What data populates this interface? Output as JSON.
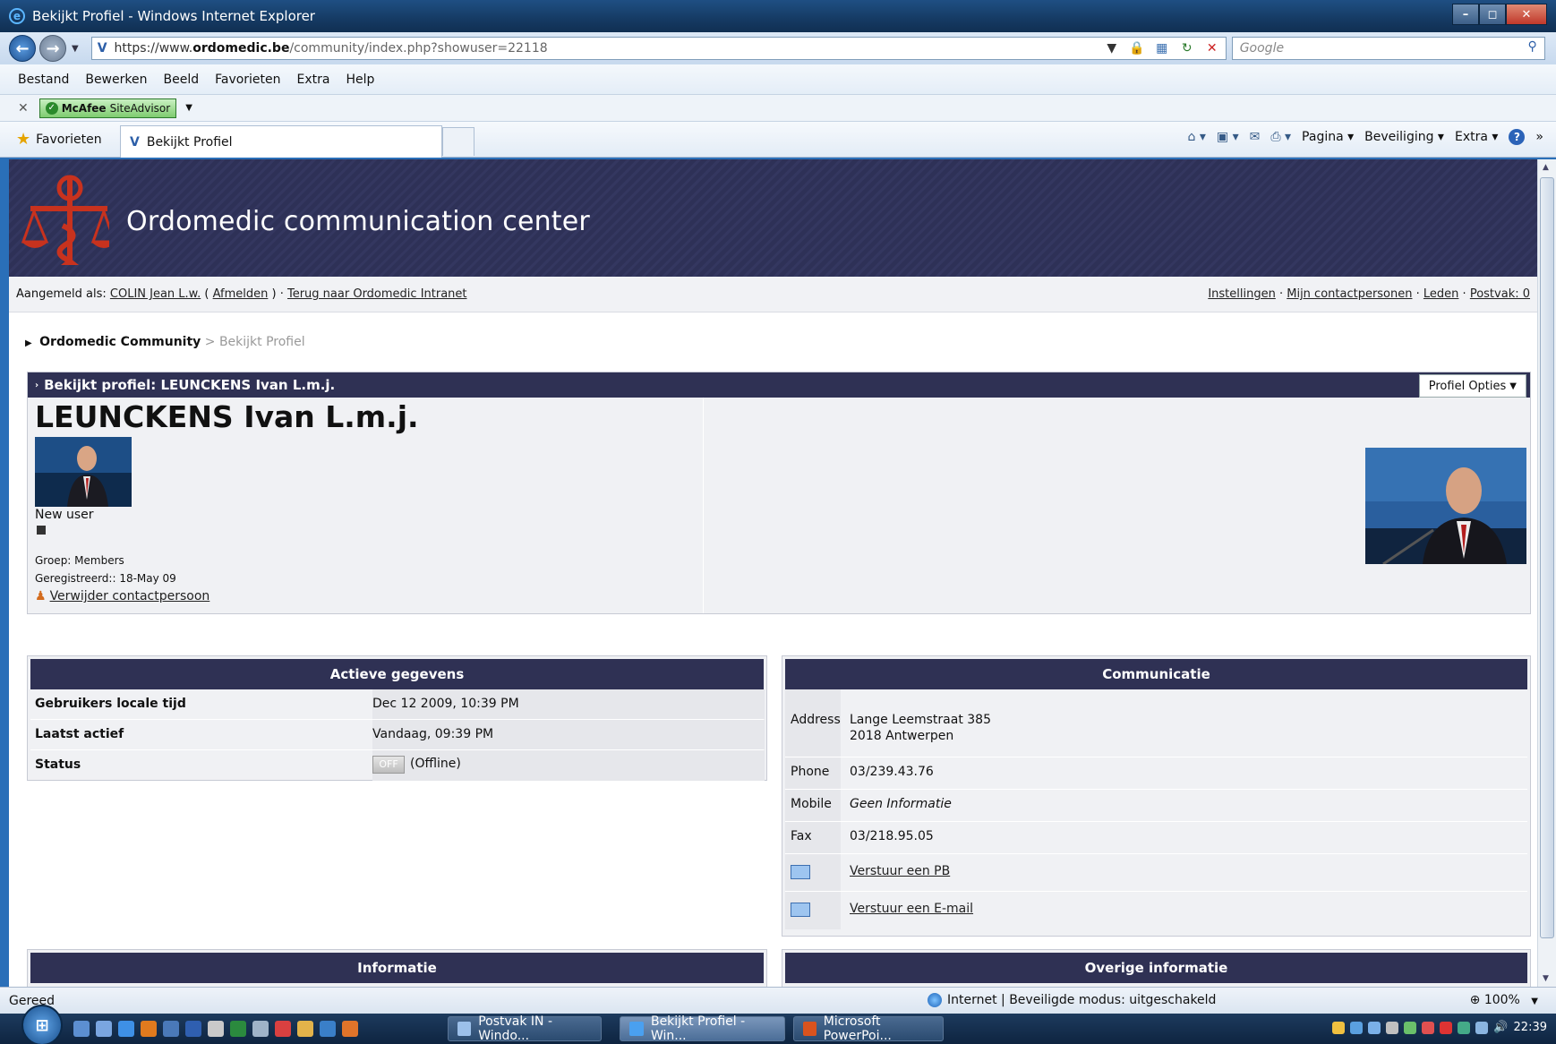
{
  "window": {
    "title": "Bekijkt Profiel - Windows Internet Explorer",
    "address": "https://www.ordomedic.be/community/index.php?showuser=22118",
    "address_parts": {
      "scheme": "https://www.",
      "domain": "ordomedic.be",
      "path": "/community/index.php?showuser=22118"
    },
    "search_placeholder": "Google",
    "menu": [
      "Bestand",
      "Bewerken",
      "Beeld",
      "Favorieten",
      "Extra",
      "Help"
    ],
    "toolbar_addon": {
      "brand": "McAfee",
      "label": "SiteAdvisor"
    },
    "favorites_label": "Favorieten",
    "tab_title": "Bekijkt Profiel",
    "commands": {
      "page": "Pagina",
      "security": "Beveiliging",
      "tools": "Extra"
    },
    "status": {
      "text": "Gereed",
      "zone": "Internet | Beveiligde modus: uitgeschakeld",
      "zoom": "100%"
    }
  },
  "site": {
    "banner_title": "Ordomedic communication center",
    "userbar": {
      "logged_in_label": "Aangemeld als:",
      "user": "COLIN Jean L.w.",
      "logout": "Afmelden",
      "back_link": "Terug naar Ordomedic Intranet",
      "right_links": [
        "Instellingen",
        "Mijn contactpersonen",
        "Leden",
        "Postvak: 0"
      ]
    },
    "breadcrumb": {
      "root": "Ordomedic Community",
      "sep": ">",
      "current": "Bekijkt Profiel"
    }
  },
  "profile": {
    "header": "Bekijkt profiel: LEUNCKENS Ivan L.m.j.",
    "options_label": "Profiel Opties",
    "name": "LEUNCKENS Ivan L.m.j.",
    "rank": "New user",
    "group": "Groep: Members",
    "registered": "Geregistreerd:: 18-May 09",
    "remove_contact": "Verwijder contactpersoon"
  },
  "active_data": {
    "title": "Actieve gegevens",
    "rows": [
      {
        "key": "Gebruikers locale tijd",
        "value": "Dec 12 2009, 10:39 PM"
      },
      {
        "key": "Laatst actief",
        "value": "Vandaag, 09:39 PM"
      },
      {
        "key": "Status",
        "value": "(Offline)",
        "badge": "OFF"
      }
    ]
  },
  "communication": {
    "title": "Communicatie",
    "address_label": "Address",
    "address_line1": "Lange Leemstraat 385",
    "address_line2": "2018 Antwerpen",
    "phone_label": "Phone",
    "phone": "03/239.43.76",
    "mobile_label": "Mobile",
    "mobile": "Geen Informatie",
    "fax_label": "Fax",
    "fax": "03/218.95.05",
    "pm_link": "Verstuur een PB",
    "email_link": "Verstuur een E-mail"
  },
  "sections": {
    "info": "Informatie",
    "other": "Overige informatie"
  },
  "taskbar": {
    "buttons": [
      "Postvak IN - Windo...",
      "Bekijkt Profiel - Win...",
      "Microsoft PowerPoi..."
    ],
    "clock": "22:39"
  }
}
